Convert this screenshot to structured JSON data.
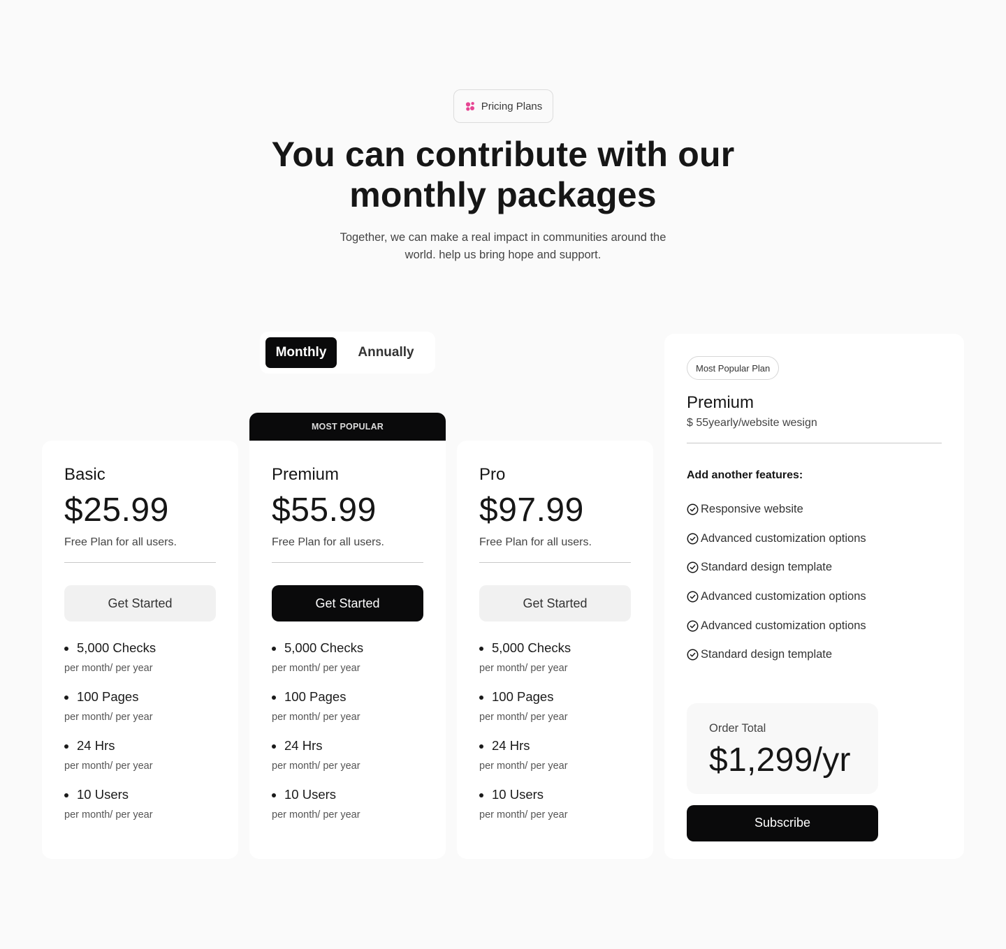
{
  "header": {
    "badge_label": "Pricing Plans",
    "badge_icon": "dots-icon",
    "accent_color": "#e64593",
    "title": "You can contribute with our monthly packages",
    "subtitle": "Together, we can make a real impact in communities around the world. help us bring hope and support."
  },
  "billing_toggle": {
    "options": [
      "Monthly",
      "Annually"
    ],
    "selected": "Monthly"
  },
  "popular_tab_label": "MOST POPULAR",
  "plans": [
    {
      "name": "Basic",
      "price": "$25.99",
      "description": "Free Plan for all users.",
      "cta_label": "Get Started",
      "cta_style": "light",
      "features": [
        {
          "title": "5,000 Checks",
          "sub": "per month/ per year"
        },
        {
          "title": "100 Pages",
          "sub": "per month/ per year"
        },
        {
          "title": "24 Hrs",
          "sub": "per month/ per year"
        },
        {
          "title": "10 Users",
          "sub": "per month/ per year"
        }
      ]
    },
    {
      "name": "Premium",
      "price": "$55.99",
      "description": "Free Plan for all users.",
      "cta_label": "Get Started",
      "cta_style": "dark",
      "features": [
        {
          "title": "5,000 Checks",
          "sub": "per month/ per year"
        },
        {
          "title": "100 Pages",
          "sub": "per month/ per year"
        },
        {
          "title": "24 Hrs",
          "sub": "per month/ per year"
        },
        {
          "title": "10 Users",
          "sub": "per month/ per year"
        }
      ]
    },
    {
      "name": "Pro",
      "price": "$97.99",
      "description": "Free Plan for all users.",
      "cta_label": "Get Started",
      "cta_style": "light",
      "features": [
        {
          "title": "5,000 Checks",
          "sub": "per month/ per year"
        },
        {
          "title": "100 Pages",
          "sub": "per month/ per year"
        },
        {
          "title": "24 Hrs",
          "sub": "per month/ per year"
        },
        {
          "title": "10 Users",
          "sub": "per month/ per year"
        }
      ]
    }
  ],
  "summary": {
    "badge_label": "Most Popular Plan",
    "plan_name": "Premium",
    "plan_price_line": "$ 55yearly/website wesign",
    "features_heading": "Add another features:",
    "addons": [
      "Responsive website",
      "Advanced customization options",
      "Standard design template",
      "Advanced customization options",
      "Advanced customization options",
      "Standard design template"
    ],
    "order_total_label": "Order Total",
    "order_total_value": "$1,299/yr",
    "subscribe_label": "Subscribe"
  }
}
